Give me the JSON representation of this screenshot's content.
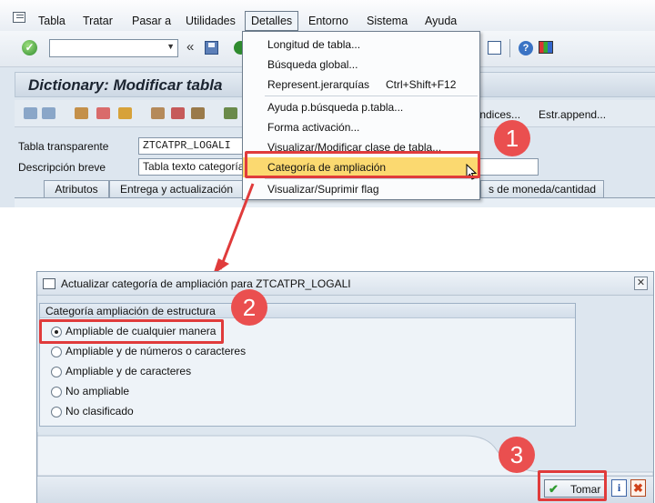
{
  "menubar": {
    "items": [
      "Tabla",
      "Tratar",
      "Pasar a",
      "Utilidades",
      "Detalles",
      "Entorno",
      "Sistema",
      "Ayuda"
    ],
    "active": "Detalles"
  },
  "toolbar": {
    "command_value": "",
    "nav_back_glyph": "«",
    "icons": [
      "ok-icon",
      "save-icon",
      "back-icon",
      "create-session-icon",
      "help-icon",
      "customize-layout-icon"
    ]
  },
  "header": {
    "title": "Dictionary: Modificar tabla"
  },
  "app_toolbar": {
    "indices_label": "Índices...",
    "estr_append_label": "Estr.append..."
  },
  "form": {
    "table_label": "Tabla transparente",
    "table_value": "ZTCATPR_LOGALI",
    "desc_label": "Descripción breve",
    "desc_value": "Tabla texto categoría"
  },
  "tabs": [
    "Atributos",
    "Entrega y actualización",
    "s de moneda/cantidad"
  ],
  "detalles_menu": {
    "items": [
      {
        "label": "Longitud de tabla..."
      },
      {
        "label": "Búsqueda global..."
      },
      {
        "label": "Represent.jerarquías",
        "shortcut": "Ctrl+Shift+F12"
      },
      {
        "label": "Ayuda p.búsqueda p.tabla..."
      },
      {
        "label": "Forma activación..."
      },
      {
        "label": "Visualizar/Modificar clase de tabla..."
      },
      {
        "label": "Categoría de ampliación",
        "highlighted": true
      },
      {
        "label": "Visualizar/Suprimir flag"
      }
    ]
  },
  "dialog": {
    "title": "Actualizar categoría de ampliación para ZTCATPR_LOGALI",
    "group_title": "Categoría ampliación de estructura",
    "options": [
      {
        "label": "Ampliable de cualquier manera",
        "checked": true
      },
      {
        "label": "Ampliable y de números o caracteres",
        "checked": false
      },
      {
        "label": "Ampliable y de caracteres",
        "checked": false
      },
      {
        "label": "No ampliable",
        "checked": false
      },
      {
        "label": "No clasificado",
        "checked": false
      }
    ],
    "buttons": {
      "ok_label": "Tomar",
      "info_glyph": "i",
      "cancel_glyph": "✖",
      "close_glyph": "✕"
    }
  },
  "annotations": {
    "badges": [
      "1",
      "2",
      "3"
    ],
    "color": "#e03b3b"
  },
  "colors": {
    "highlight": "#fbd970",
    "background": "#dde6ef"
  }
}
